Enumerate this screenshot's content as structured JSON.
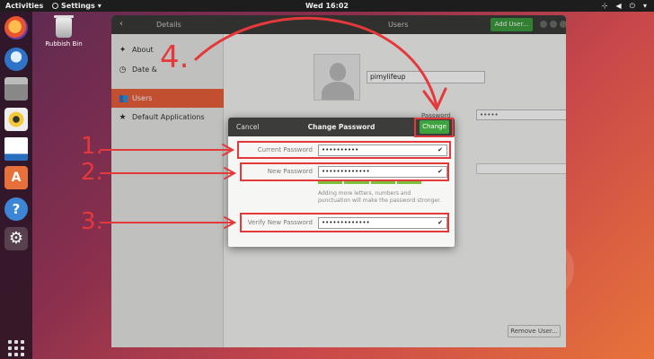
{
  "topbar": {
    "activities": "Activities",
    "app_name": "Settings",
    "clock": "Wed 16:02"
  },
  "desktop": {
    "trash_label": "Rubbish Bin"
  },
  "window": {
    "left_title": "Details",
    "right_title": "Users",
    "add_user_label": "Add User...",
    "sidebar": [
      {
        "label": "About",
        "icon": "star-icon"
      },
      {
        "label": "Date &",
        "icon": "clock-icon"
      },
      {
        "label": "Users",
        "icon": "users-icon",
        "active": true
      },
      {
        "label": "Default Applications",
        "icon": "star-icon"
      }
    ],
    "username_value": "pimylifeup",
    "password_label": "Password",
    "password_value": "•••••",
    "remove_user_label": "Remove User..."
  },
  "dialog": {
    "cancel_label": "Cancel",
    "title": "Change Password",
    "change_label": "Change",
    "current_password_label": "Current Password",
    "current_password_value": "••••••••••",
    "new_password_label": "New Password",
    "new_password_value": "•••••••••••••",
    "strength_hint": "Adding more letters, numbers and punctuation will make the password stronger.",
    "verify_password_label": "Verify New Password",
    "verify_password_value": "•••••••••••••"
  },
  "annotations": {
    "step1": "1.",
    "step2": "2.",
    "step3": "3.",
    "step4": "4."
  },
  "colors": {
    "accent_orange": "#e9603a",
    "change_green": "#3ea33e",
    "annotation_red": "#e5383b",
    "header_dark": "#3a3a38"
  }
}
